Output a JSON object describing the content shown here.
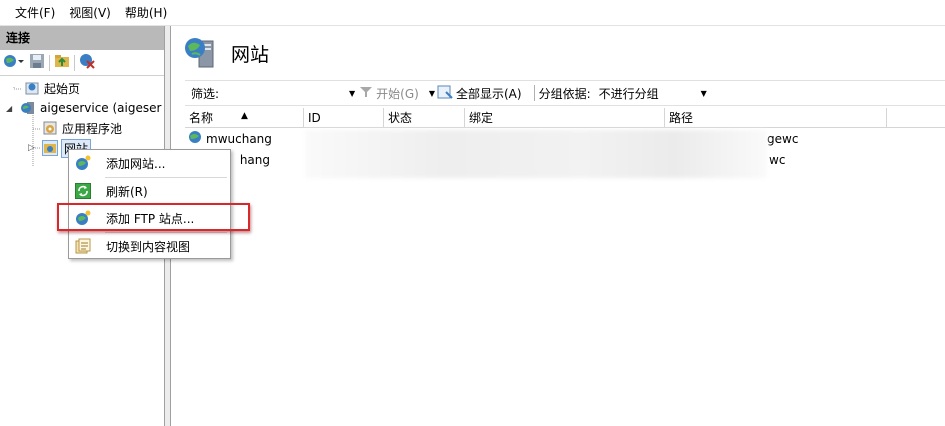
{
  "menubar": {
    "file": "文件(F)",
    "view": "视图(V)",
    "help": "帮助(H)"
  },
  "left": {
    "title": "连接",
    "tree": {
      "start_page": "起始页",
      "server": "aigeservice (aigeser",
      "app_pools": "应用程序池",
      "sites": "网站"
    }
  },
  "context_menu": {
    "add_website": "添加网站...",
    "refresh": "刷新(R)",
    "add_ftp": "添加 FTP 站点...",
    "switch_content": "切换到内容视图"
  },
  "right": {
    "title": "网站",
    "filterbar": {
      "filter_label": "筛选:",
      "start": "开始(G)",
      "show_all": "全部显示(A)",
      "group_by": "分组依据:",
      "group_value": "不进行分组"
    },
    "columns": [
      "名称",
      "ID",
      "状态",
      "绑定",
      "路径"
    ],
    "rows": [
      {
        "name": "mwuchang",
        "path_tail": "gewc"
      },
      {
        "name": "hang",
        "path_tail": "wc"
      }
    ]
  },
  "colors": {
    "highlight": "#d8282b",
    "left_title_bg": "#b9b9b9"
  }
}
